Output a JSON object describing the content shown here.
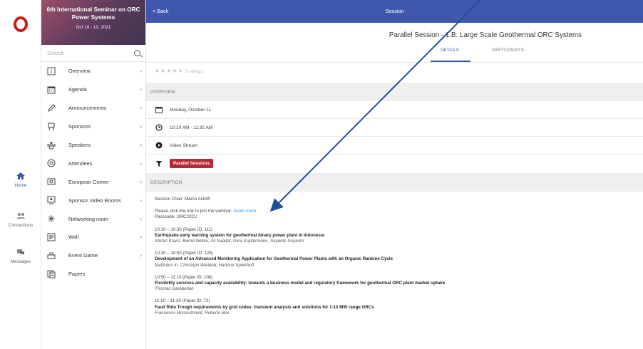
{
  "rail": {
    "items": [
      {
        "label": "Home",
        "icon": "home-icon"
      },
      {
        "label": "Connections",
        "icon": "people-icon"
      },
      {
        "label": "Messages",
        "icon": "chat-bubbles-icon"
      }
    ]
  },
  "event": {
    "title": "6th International Seminar on ORC Power Systems",
    "dates": "Oct 10 - 13, 2021"
  },
  "search": {
    "placeholder": "Search"
  },
  "menu": [
    {
      "label": "Overview",
      "icon": "info-icon"
    },
    {
      "label": "Agenda",
      "icon": "calendar-icon"
    },
    {
      "label": "Announcements",
      "icon": "pen-icon"
    },
    {
      "label": "Sponsors",
      "icon": "easel-icon"
    },
    {
      "label": "Speakers",
      "icon": "podium-icon"
    },
    {
      "label": "Attendees",
      "icon": "badge-icon"
    },
    {
      "label": "European Corner",
      "icon": "picture-icon"
    },
    {
      "label": "Sponsor Video Rooms",
      "icon": "video-screen-icon"
    },
    {
      "label": "Networking room",
      "icon": "network-icon"
    },
    {
      "label": "Wall",
      "icon": "wall-post-icon"
    },
    {
      "label": "Event Game",
      "icon": "game-icon"
    },
    {
      "label": "Papers",
      "icon": "papers-icon"
    }
  ],
  "header": {
    "back": "< Back",
    "title": "Session"
  },
  "session": {
    "title": "Parallel Session - 1.B: Large Scale Geothermal ORC Systems",
    "tabs": [
      "DETAILS",
      "PARTICIPANTS"
    ],
    "stars": "★★★★★",
    "ratings": "0 ratings",
    "overview_label": "OVERVIEW",
    "date": "Monday, October 11",
    "time": "10:10 AM - 11:30 AM",
    "stream": "Video Stream",
    "track": "Parallel Sessions",
    "description_label": "DESCRIPTION"
  },
  "description": {
    "chair": "Session Chair: Marco Astolfi",
    "join_text": "Please click this link to join the webinar: ",
    "join_link": "Zoom room",
    "passcode": "Passcode: ORC2021!",
    "papers": [
      {
        "slot": "10:10 – 10:30 (Paper ID: 111)",
        "title": "Earthquake early warning system for geothermal binary power plant in Indonesia",
        "authors": "Stefan Kranz, Bernd Weber, Ali Saadat, Gina Kupfermann, Suyanto Suyanto"
      },
      {
        "slot": "10:30 – 10:50 (Paper ID: 128)",
        "title": "Development of an Advanced Monitoring Application for Geothermal Power Plants with an Organic Rankine Cycle",
        "authors": "Matthäus Irl, Christoph Wieland, Hartmut Spliethoff"
      },
      {
        "slot": "10:50 – 11:10 (Paper ID: 106)",
        "title": "Flexibility services and capacity availability: towards a business model and regulatory framework for geothermal ORC plant market uptake",
        "authors": "Thomas Garabetian"
      },
      {
        "slot": "11:10 – 11:30 (Paper ID: 72)",
        "title": "Fault Ride Trough requirements by grid codes: transient analysis and solutions for 1-10 MW range ORCs",
        "authors": "Francesco Moraschinelli, Roberto Bini"
      }
    ]
  },
  "colors": {
    "header": "#3f58ad",
    "tag": "#b62935",
    "link": "#2f8bd8",
    "arrow": "#1f4f9a"
  }
}
